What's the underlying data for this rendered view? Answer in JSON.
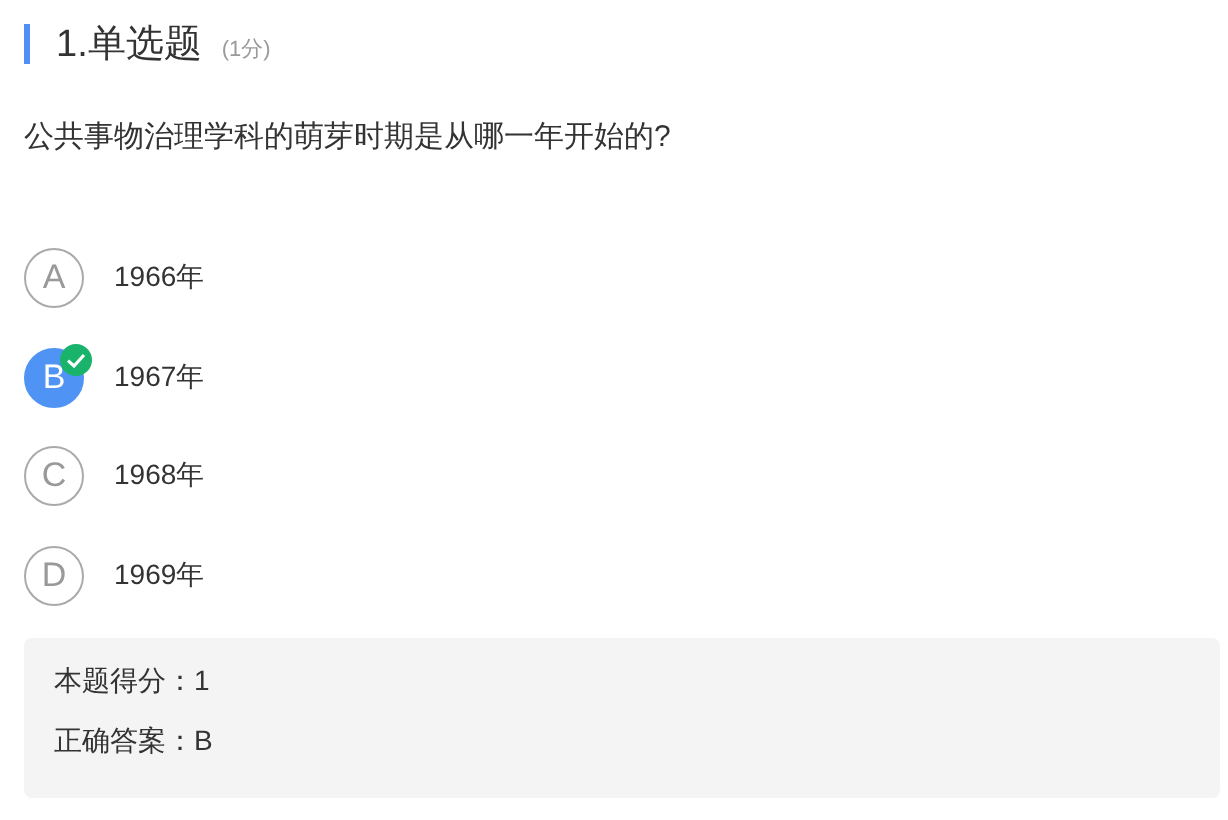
{
  "question": {
    "number_title": "1.单选题",
    "points": "(1分)",
    "text": "公共事物治理学科的萌芽时期是从哪一年开始的?"
  },
  "options": [
    {
      "letter": "A",
      "text": "1966年",
      "selected": false
    },
    {
      "letter": "B",
      "text": "1967年",
      "selected": true
    },
    {
      "letter": "C",
      "text": "1968年",
      "selected": false
    },
    {
      "letter": "D",
      "text": "1969年",
      "selected": false
    }
  ],
  "result": [
    {
      "label": "本题得分：",
      "value": "1"
    },
    {
      "label": "正确答案：",
      "value": "B"
    }
  ]
}
